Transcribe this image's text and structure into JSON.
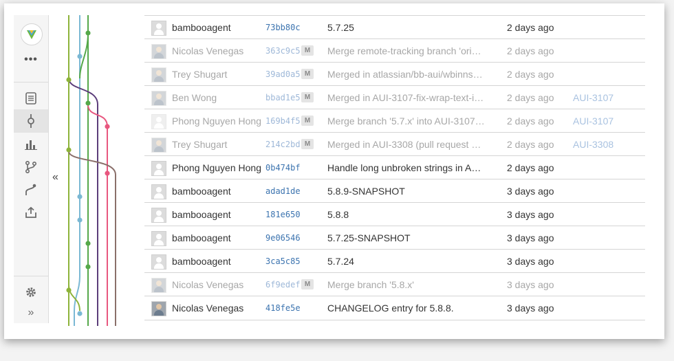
{
  "sidebar": {
    "logo_icon": "bitbucket-logo-icon",
    "more_label": "•••",
    "collapse_label": "»",
    "items": [
      {
        "icon": "source-icon"
      },
      {
        "icon": "commits-icon"
      },
      {
        "icon": "stats-icon"
      },
      {
        "icon": "branches-icon"
      },
      {
        "icon": "pull-requests-icon"
      },
      {
        "icon": "upload-icon"
      }
    ],
    "settings_icon": "gear-icon"
  },
  "expand_label": "«",
  "commits": [
    {
      "author": "bambooagent",
      "hash": "73bb80c",
      "merge": false,
      "message": "5.7.25",
      "time": "2 days ago",
      "issue": "",
      "avatar": "default"
    },
    {
      "author": "Nicolas Venegas",
      "hash": "363c9c5",
      "merge": true,
      "merge_label": "M",
      "message": "Merge remote-tracking branch 'origin/...",
      "time": "2 days ago",
      "issue": "",
      "avatar": "photo"
    },
    {
      "author": "Trey Shugart",
      "hash": "39ad0a5",
      "merge": true,
      "merge_label": "M",
      "message": "Merged in atlassian/bb-aui/wbinnssmi...",
      "time": "2 days ago",
      "issue": "",
      "avatar": "photo"
    },
    {
      "author": "Ben Wong",
      "hash": "bbad1e5",
      "merge": true,
      "merge_label": "M",
      "message": "Merged in AUI-3107-fix-wrap-text-in-t...",
      "time": "2 days ago",
      "issue": "AUI-3107",
      "avatar": "photo"
    },
    {
      "author": "Phong Nguyen Hong",
      "hash": "169b4f5",
      "merge": true,
      "merge_label": "M",
      "message": "Merge branch '5.7.x' into AUI-3107-fi...",
      "time": "2 days ago",
      "issue": "AUI-3107",
      "avatar": "default"
    },
    {
      "author": "Trey Shugart",
      "hash": "214c2bd",
      "merge": true,
      "merge_label": "M",
      "message": "Merged in AUI-3308 (pull request #1...",
      "time": "2 days ago",
      "issue": "AUI-3308",
      "avatar": "photo"
    },
    {
      "author": "Phong Nguyen Hong",
      "hash": "0b474bf",
      "merge": false,
      "message": "Handle long unbroken strings in AUI ...",
      "time": "2 days ago",
      "issue": "",
      "avatar": "default"
    },
    {
      "author": "bambooagent",
      "hash": "adad1de",
      "merge": false,
      "message": "5.8.9-SNAPSHOT",
      "time": "3 days ago",
      "issue": "",
      "avatar": "default"
    },
    {
      "author": "bambooagent",
      "hash": "181e650",
      "merge": false,
      "message": "5.8.8",
      "time": "3 days ago",
      "issue": "",
      "avatar": "default"
    },
    {
      "author": "bambooagent",
      "hash": "9e06546",
      "merge": false,
      "message": "5.7.25-SNAPSHOT",
      "time": "3 days ago",
      "issue": "",
      "avatar": "default"
    },
    {
      "author": "bambooagent",
      "hash": "3ca5c85",
      "merge": false,
      "message": "5.7.24",
      "time": "3 days ago",
      "issue": "",
      "avatar": "default"
    },
    {
      "author": "Nicolas Venegas",
      "hash": "6f9edef",
      "merge": true,
      "merge_label": "M",
      "message": "Merge branch '5.8.x'",
      "time": "3 days ago",
      "issue": "",
      "avatar": "photo"
    },
    {
      "author": "Nicolas Venegas",
      "hash": "418fe5e",
      "merge": false,
      "message": "CHANGELOG entry for 5.8.8.",
      "time": "3 days ago",
      "issue": "",
      "avatar": "photo"
    }
  ],
  "graph_colors": {
    "olive": "#8db33a",
    "blue": "#7ab8d4",
    "green": "#55a84a",
    "purple": "#5b3d7a",
    "pink": "#e8577f",
    "brown": "#8a6f6a"
  }
}
